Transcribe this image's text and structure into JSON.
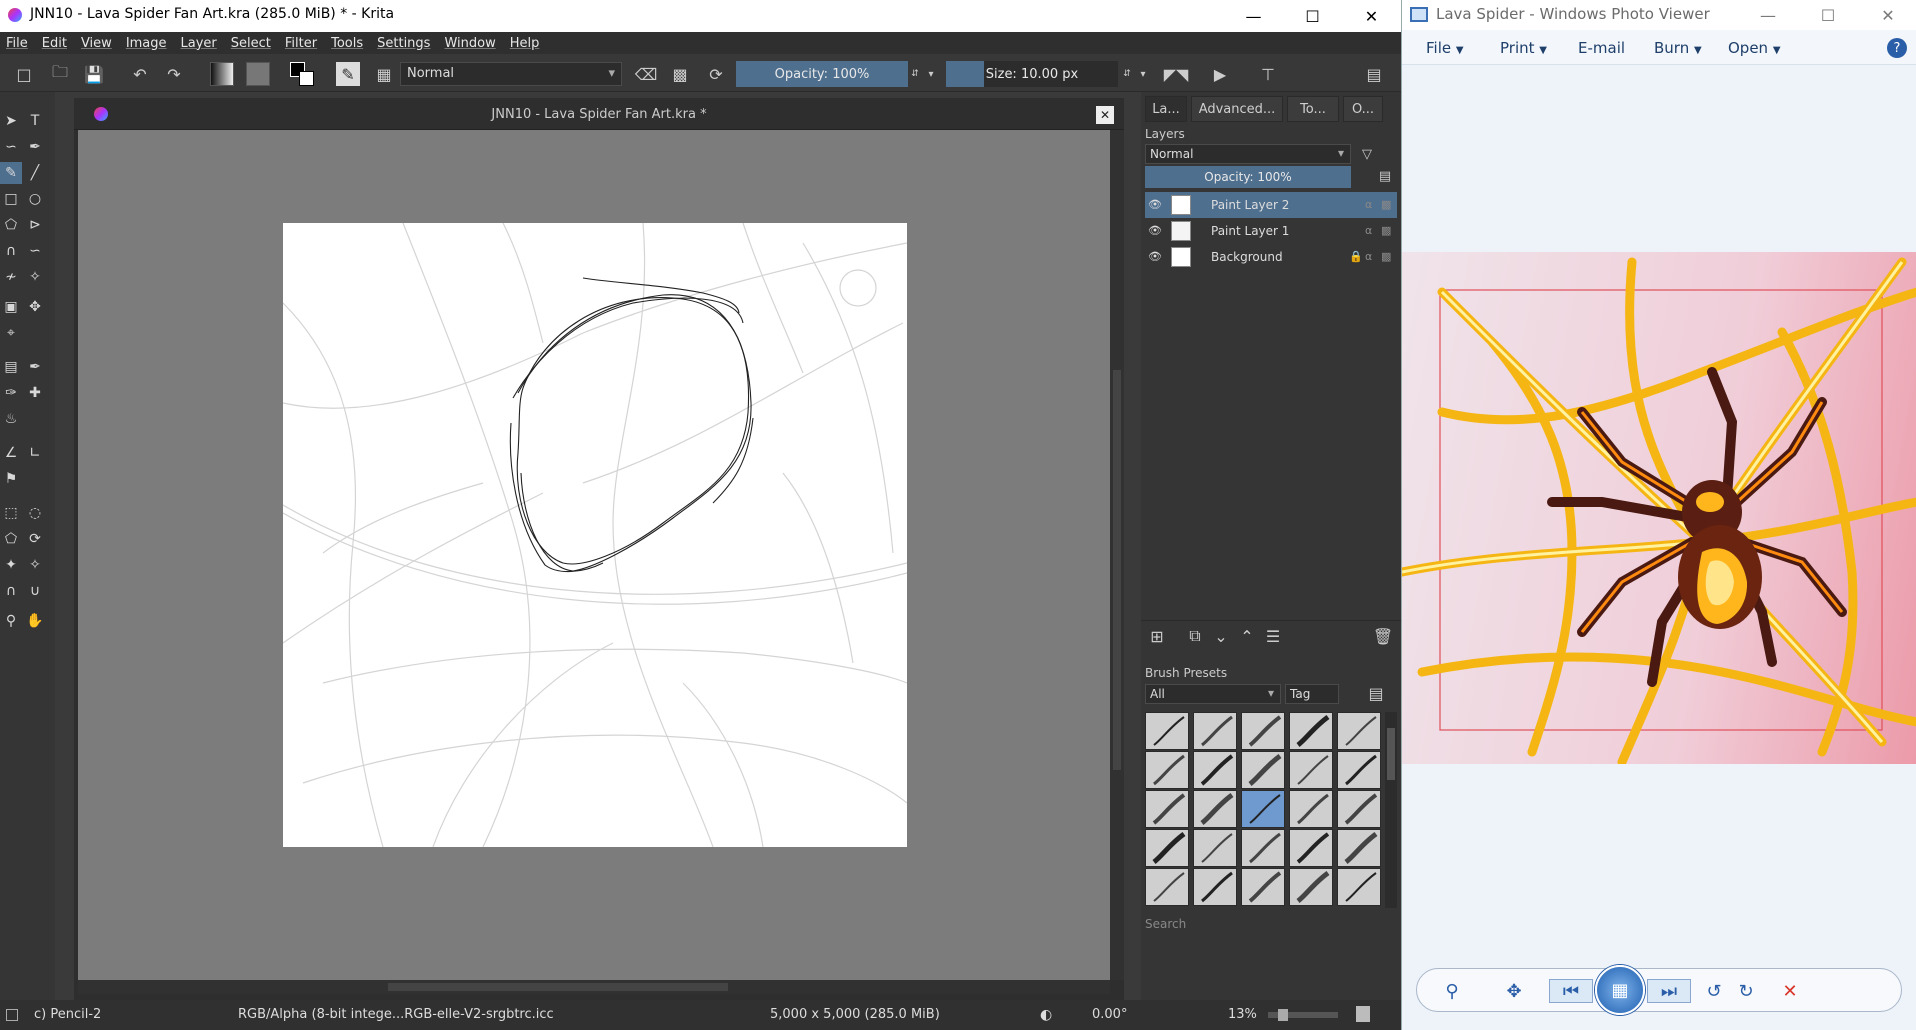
{
  "krita": {
    "window_title": "JNN10 - Lava Spider Fan Art.kra (285.0 MiB)  * - Krita",
    "menu": [
      "File",
      "Edit",
      "View",
      "Image",
      "Layer",
      "Select",
      "Filter",
      "Tools",
      "Settings",
      "Window",
      "Help"
    ],
    "toolbar": {
      "blend_mode": "Normal",
      "opacity_label": "Opacity: 100%",
      "size_label": "Size: 10.00 px"
    },
    "document_tab": "JNN10 - Lava Spider Fan Art.kra *",
    "dock_tabs": [
      "La...",
      "Advanced...",
      "To...",
      "O..."
    ],
    "layers": {
      "title": "Layers",
      "blend_mode": "Normal",
      "opacity_label": "Opacity:  100%",
      "items": [
        {
          "name": "Paint Layer 2",
          "selected": true
        },
        {
          "name": "Paint Layer 1",
          "selected": false
        },
        {
          "name": "Background",
          "selected": false
        }
      ]
    },
    "brush_presets": {
      "title": "Brush Presets",
      "filter": "All",
      "tag_label": "Tag",
      "search_placeholder": "Search",
      "selected_index": 12
    },
    "status": {
      "brush": "c) Pencil-2",
      "color_profile": "RGB/Alpha (8-bit intege...RGB-elle-V2-srgbtrc.icc",
      "dimensions": "5,000 x 5,000 (285.0 MiB)",
      "rotation": "0.00°",
      "zoom": "13%"
    }
  },
  "photo_viewer": {
    "window_title": "Lava Spider - Windows Photo Viewer",
    "menu": [
      "File",
      "Print",
      "E-mail",
      "Burn",
      "Open"
    ],
    "colors": {
      "accent": "#2b5ea8",
      "close": "#d9372b"
    }
  }
}
